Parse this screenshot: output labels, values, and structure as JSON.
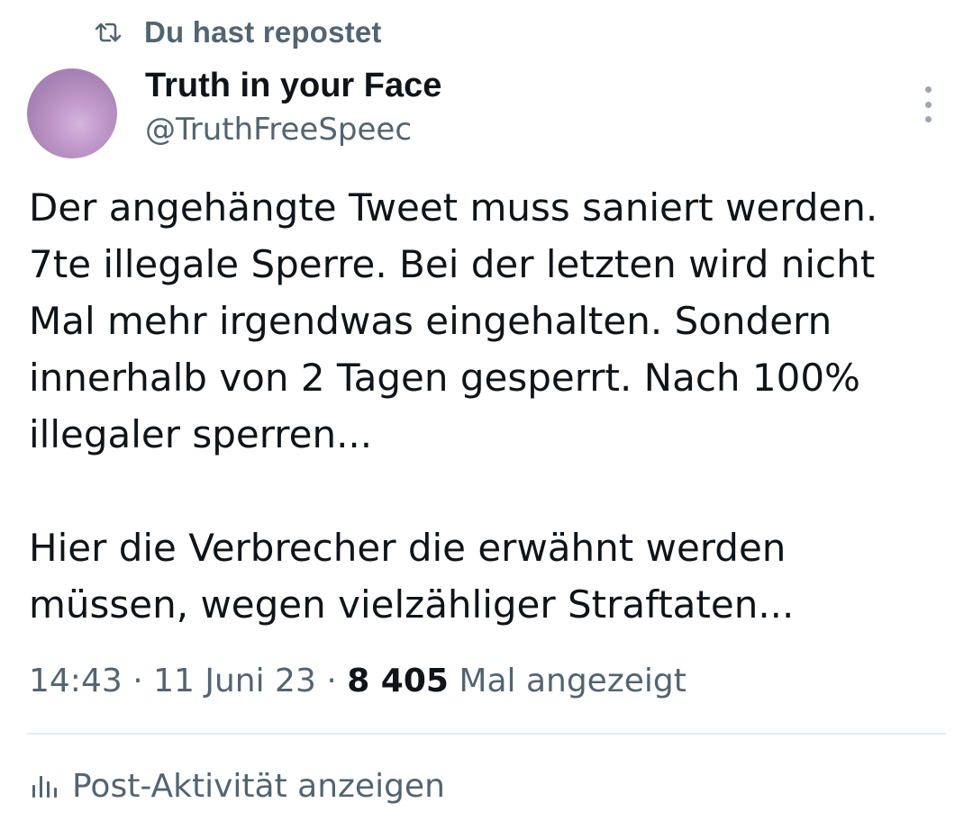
{
  "repost": {
    "label": "Du hast repostet",
    "icon": "repost-icon"
  },
  "author": {
    "name": "Truth in your Face",
    "handle": "@TruthFreeSpeec",
    "avatar_color": "#b891c3"
  },
  "more_menu": {
    "icon": "more-vertical-icon"
  },
  "tweet": {
    "lines": [
      "Der angehängte Tweet muss saniert werden.",
      "7te illegale Sperre. Bei der letzten wird nicht",
      "Mal mehr irgendwas eingehalten. Sondern",
      "innerhalb von 2 Tagen gesperrt. Nach 100%",
      "illegaler sperren...",
      "",
      "Hier die Verbrecher die erwähnt werden",
      "müssen, wegen vielzähliger Straftaten..."
    ]
  },
  "meta": {
    "time": "14:43",
    "separator": "·",
    "date": "11 Juni 23",
    "views_count": "8 405",
    "views_label": "Mal angezeigt"
  },
  "activity": {
    "label": "Post-Aktivität anzeigen",
    "icon": "analytics-icon"
  },
  "colors": {
    "text_primary": "#0f1419",
    "text_secondary": "#536471",
    "divider": "#e6eaed"
  }
}
